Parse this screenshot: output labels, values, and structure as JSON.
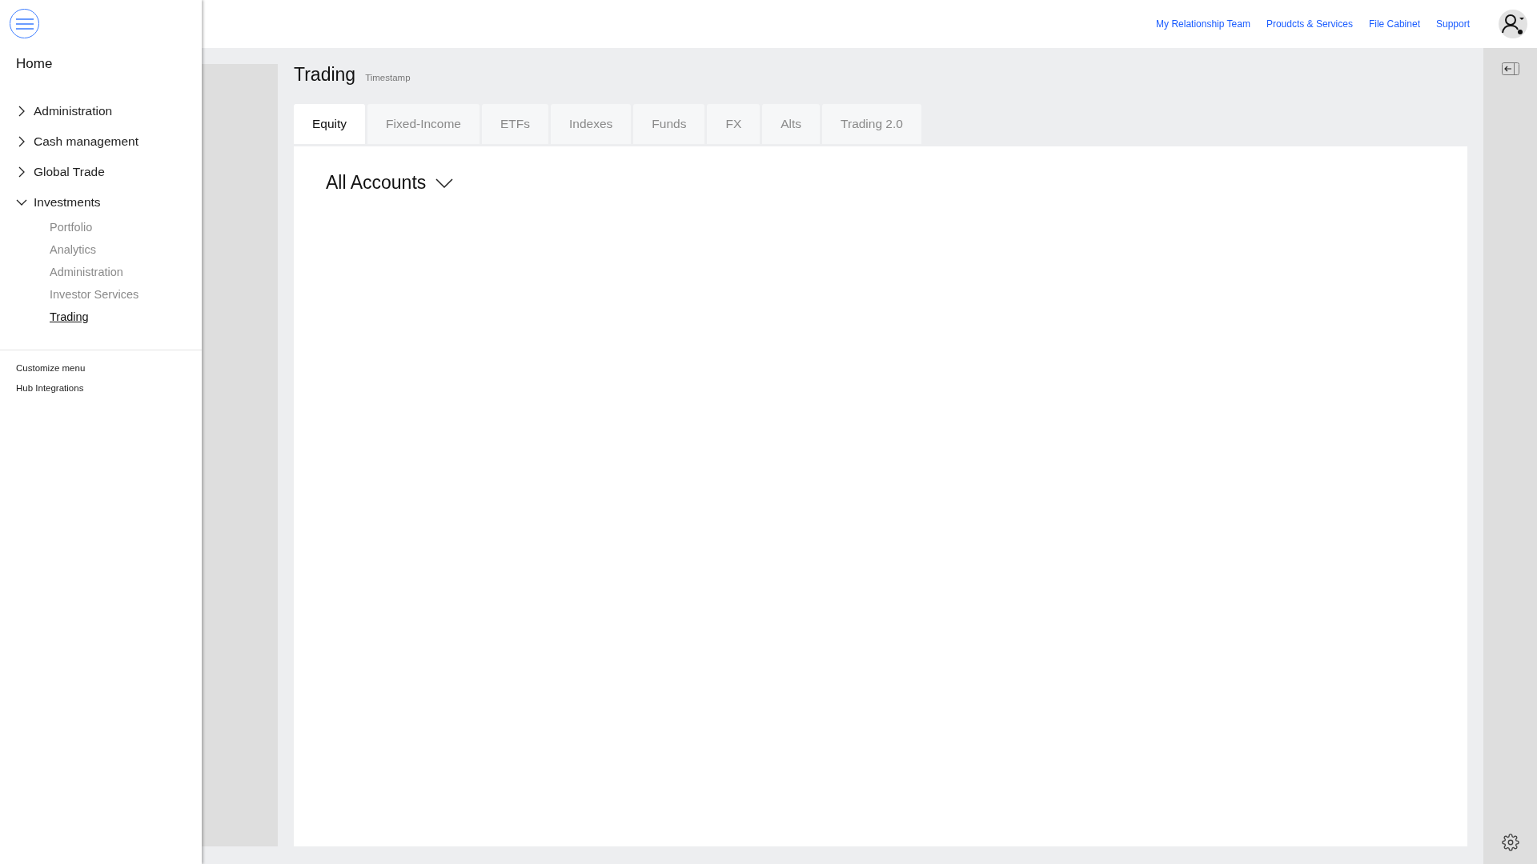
{
  "sidebar": {
    "home": "Home",
    "items": [
      {
        "label": "Administration",
        "expanded": false
      },
      {
        "label": "Cash management",
        "expanded": false
      },
      {
        "label": "Global Trade",
        "expanded": false
      },
      {
        "label": "Investments",
        "expanded": true,
        "children": [
          {
            "label": "Portfolio",
            "selected": false
          },
          {
            "label": "Analytics",
            "selected": false
          },
          {
            "label": "Administration",
            "selected": false
          },
          {
            "label": "Investor Services",
            "selected": false
          },
          {
            "label": "Trading",
            "selected": true
          }
        ]
      }
    ],
    "footer_links": [
      "Customize menu",
      "Hub Integrations"
    ]
  },
  "top_nav": {
    "links": [
      "My Relationship Team",
      "Proudcts & Services",
      "File Cabinet",
      "Support"
    ]
  },
  "page": {
    "title": "Trading",
    "timestamp": "Timestamp",
    "tabs": [
      {
        "label": "Equity",
        "selected": true
      },
      {
        "label": "Fixed-Income",
        "selected": false
      },
      {
        "label": "ETFs",
        "selected": false
      },
      {
        "label": "Indexes",
        "selected": false
      },
      {
        "label": "Funds",
        "selected": false
      },
      {
        "label": "FX",
        "selected": false
      },
      {
        "label": "Alts",
        "selected": false
      },
      {
        "label": "Trading 2.0",
        "selected": false
      }
    ],
    "account_selector": "All Accounts"
  }
}
